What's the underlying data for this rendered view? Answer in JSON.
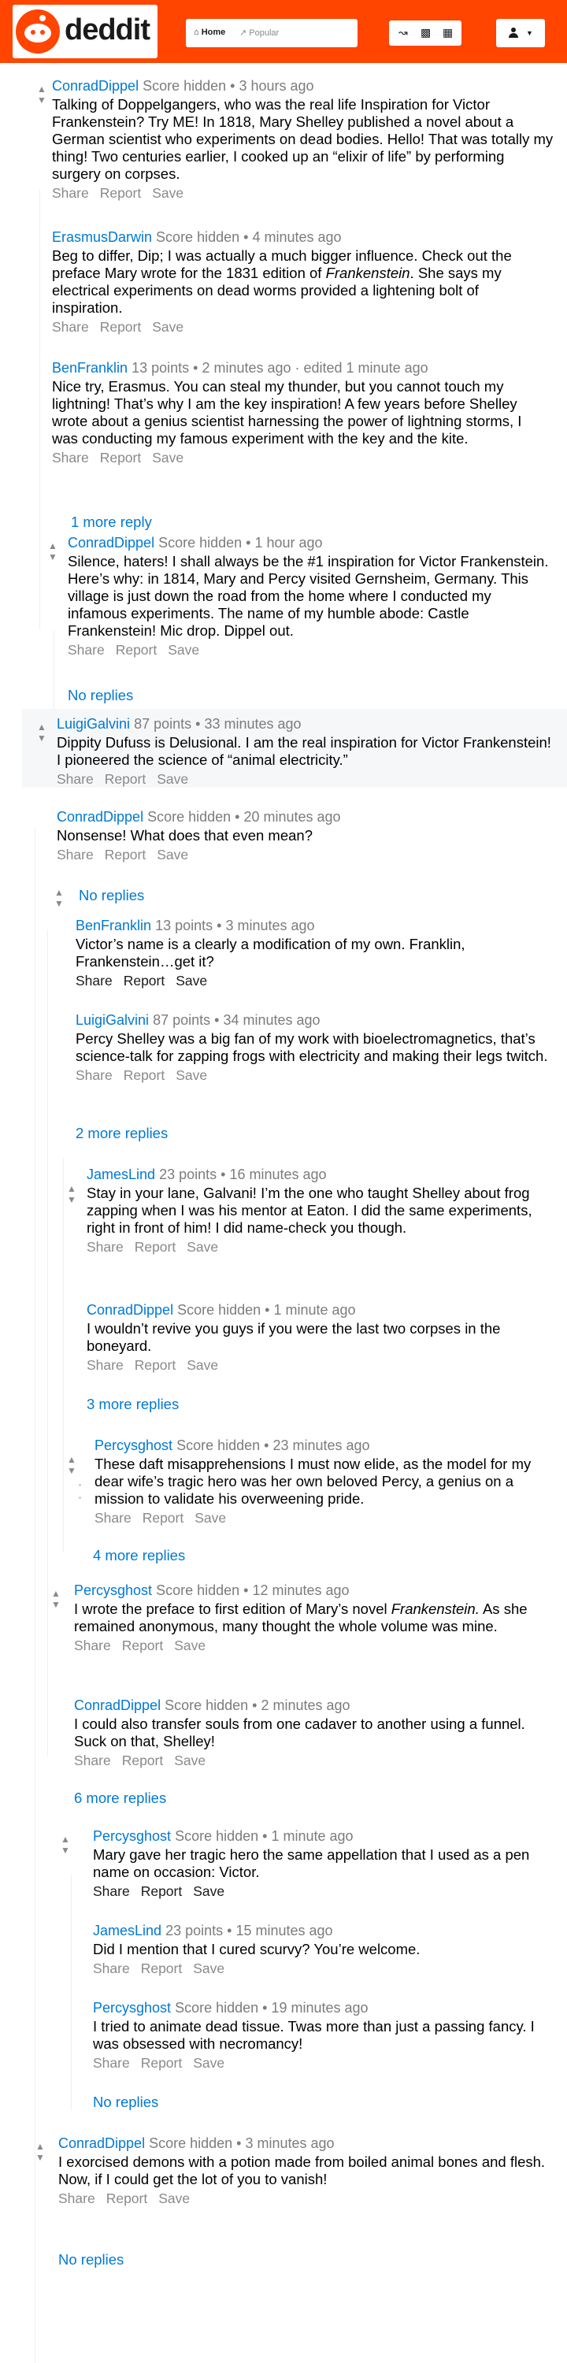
{
  "header": {
    "logo_text": "deddit",
    "feed_home": "Home",
    "feed_popular": "Popular",
    "icons": [
      "trending-icon",
      "stats-icon",
      "grid-icon"
    ]
  },
  "comments": [
    {
      "author": "ConradDippel",
      "score": "Score hidden",
      "time": "3 hours ago",
      "body": "Talking of Doppelgangers, who was the real life Inspiration for Victor Frankenstein? Try ME! In 1818, Mary Shelley published a novel about a German scientist who experiments on dead bodies. Hello! That was totally my thing! Two centuries earlier, I cooked up an “elixir of life” by performing surgery on corpses."
    },
    {
      "author": "ErasmusDarwin",
      "score": "Score hidden",
      "time": "4 minutes ago",
      "body_pre": "Beg to differ, Dip; I was actually a much bigger influence. Check out the preface Mary wrote for the 1831 edition of ",
      "body_em": "Frankenstein",
      "body_post": ". She says my electrical experiments on dead worms provided a lightening bolt of inspiration."
    },
    {
      "author": "BenFranklin",
      "score": "13 points",
      "time": "2 minutes ago · edited 1 minute ago",
      "body": "Nice try, Erasmus. You can steal my thunder, but you cannot touch my lightning! That’s why I am the key inspiration! A few years before Shelley wrote about a genius scientist harnessing the power of lightning storms, I was conducting my famous experiment with the key and the kite."
    },
    {
      "author": "ConradDippel",
      "score": "Score hidden",
      "time": "1 hour ago",
      "body": "Silence, haters! I shall always be the #1 inspiration for Victor Frankenstein. Here’s why: in 1814, Mary and Percy visited Gernsheim, Germany. This village is just down the road from the home where I conducted my infamous experiments. The name of my humble abode: Castle Frankenstein! Mic drop. Dippel out."
    },
    {
      "author": "LuigiGalvini",
      "score": "87 points",
      "time": "33 minutes ago",
      "body": "Dippity Dufuss is Delusional. I am the real inspiration for Victor Frankenstein! I pioneered the science of “animal electricity.”"
    },
    {
      "author": "ConradDippel",
      "score": "Score hidden",
      "time": "20 minutes ago",
      "body": "Nonsense! What does that even mean?"
    },
    {
      "author": "BenFranklin",
      "score": "13 points",
      "time": "3 minutes ago",
      "body": "Victor’s name is a clearly a modification of my own. Franklin, Frankenstein…get it?"
    },
    {
      "author": "LuigiGalvini",
      "score": "87 points",
      "time": "34 minutes ago",
      "body": "Percy Shelley was a big fan of my work with bioelectromagnetics, that’s science-talk for zapping frogs with electricity and making their legs twitch."
    },
    {
      "author": "JamesLind",
      "score": "23 points",
      "time": "16 minutes ago",
      "body": "Stay in your lane, Galvani! I’m the one who taught Shelley about frog zapping when I was his mentor at Eaton. I did the same experiments, right in front of him! I did name-check you though."
    },
    {
      "author": "ConradDippel",
      "score": "Score hidden",
      "time": "1 minute ago",
      "body": "I wouldn’t revive you guys if you were the last two corpses in the boneyard."
    },
    {
      "author": "Percysghost",
      "score": "Score hidden",
      "time": "23 minutes ago",
      "body": "These daft misapprehensions I must now elide, as the model for my dear wife’s tragic hero was her own beloved Percy, a genius on a mission to validate his overweening pride."
    },
    {
      "author": "Percysghost",
      "score": "Score hidden",
      "time": "12 minutes ago",
      "body_pre": "I wrote the preface to first edition of Mary’s novel ",
      "body_em": "Frankenstein.",
      "body_post": " As she remained anonymous, many thought the whole volume was mine."
    },
    {
      "author": "ConradDippel",
      "score": "Score hidden",
      "time": "2 minutes ago",
      "body": "I could also transfer souls from one cadaver to another using a funnel. Suck on that, Shelley!"
    },
    {
      "author": "Percysghost",
      "score": "Score hidden",
      "time": "1 minute ago",
      "body": "Mary gave her tragic hero the same appellation that I used as a pen name on occasion: Victor."
    },
    {
      "author": "JamesLind",
      "score": "23 points",
      "time": "15 minutes ago",
      "body": "Did I mention that I cured scurvy? You’re welcome."
    },
    {
      "author": "Percysghost",
      "score": "Score hidden",
      "time": "19 minutes ago",
      "body": "I tried to animate dead tissue. Twas more than just a passing fancy. I was obsessed with necromancy!"
    },
    {
      "author": "ConradDippel",
      "score": "Score hidden",
      "time": "3 minutes ago",
      "body": "I exorcised demons with a potion made from boiled animal bones and flesh. Now, if I could get the lot of you to vanish!"
    }
  ],
  "actions": {
    "share": "Share",
    "report": "Report",
    "save": "Save"
  },
  "more_links": [
    "1 more reply",
    "No replies",
    "No replies",
    "2 more replies",
    "3 more replies",
    "4 more replies",
    "6 more replies",
    "No replies",
    "No replies"
  ]
}
